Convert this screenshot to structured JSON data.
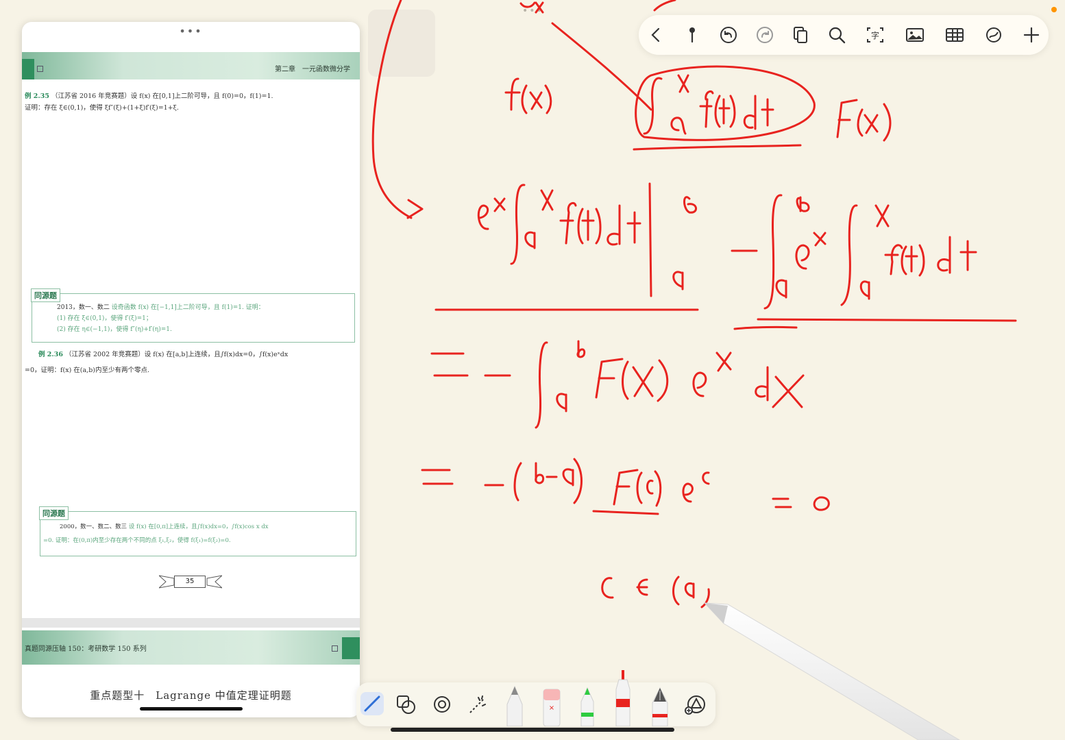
{
  "pdf": {
    "grabber": "•••",
    "chapter_header": "第二章　一元函数微分学",
    "problem_235": {
      "number": "例 2.35",
      "line1": "（江苏省 2016 年竞赛题）设 f(x) 在[0,1]上二阶可导，且 f(0)=0，f(1)=1.",
      "line2": "证明：存在 ξ∈(0,1)，使得 ξf″(ξ)+(1+ξ)f′(ξ)=1+ξ."
    },
    "same_source_label": "同源题",
    "same_source_1": {
      "year": "2013，数一、数二",
      "line1": "设奇函数 f(x) 在[−1,1]上二阶可导，且 f(1)=1. 证明：",
      "line2": "(1) 存在 ξ∈(0,1)，使得 f′(ξ)=1；",
      "line3": "(2) 存在 η∈(−1,1)，使得 f″(η)+f′(η)=1."
    },
    "problem_236": {
      "number": "例 2.36",
      "line1": "（江苏省 2002 年竞赛题）设 f(x) 在[a,b]上连续，且∫f(x)dx=0，∫f(x)eˣdx",
      "line2": "=0，证明：f(x) 在(a,b)内至少有两个零点."
    },
    "same_source_2": {
      "year": "2000，数一、数二、数三",
      "line1": "设 f(x) 在[0,π]上连续，且∫f(x)dx=0，∫f(x)cos x dx",
      "line2": "=0. 证明：在(0,π)内至少存在两个不同的点 ξ₁,ξ₂，使得 f(ξ₁)=f(ξ₂)=0."
    },
    "page_number": "35",
    "series_header": "真题同源压轴 150：考研数学 150 系列",
    "section_title": "重点题型十　Lagrange 中值定理证明题"
  },
  "top_toolbar": {
    "icons": [
      "back-icon",
      "pin-icon",
      "undo-icon",
      "redo-icon",
      "pages-icon",
      "search-icon",
      "text-recognition-icon",
      "image-icon",
      "table-icon",
      "shape-tool-icon",
      "add-icon"
    ]
  },
  "tool_dock": {
    "icons": [
      "pen-icon",
      "lasso-icon",
      "zoom-lens-icon",
      "laser-icon",
      "pencil-icon",
      "eraser-icon",
      "highlighter-icon",
      "marker-icon",
      "fountain-pen-icon",
      "shapes-icon"
    ]
  },
  "colors": {
    "ink": "#e8231f",
    "canvas": "#f7f3e6",
    "book_green": "#2f8f5e"
  }
}
